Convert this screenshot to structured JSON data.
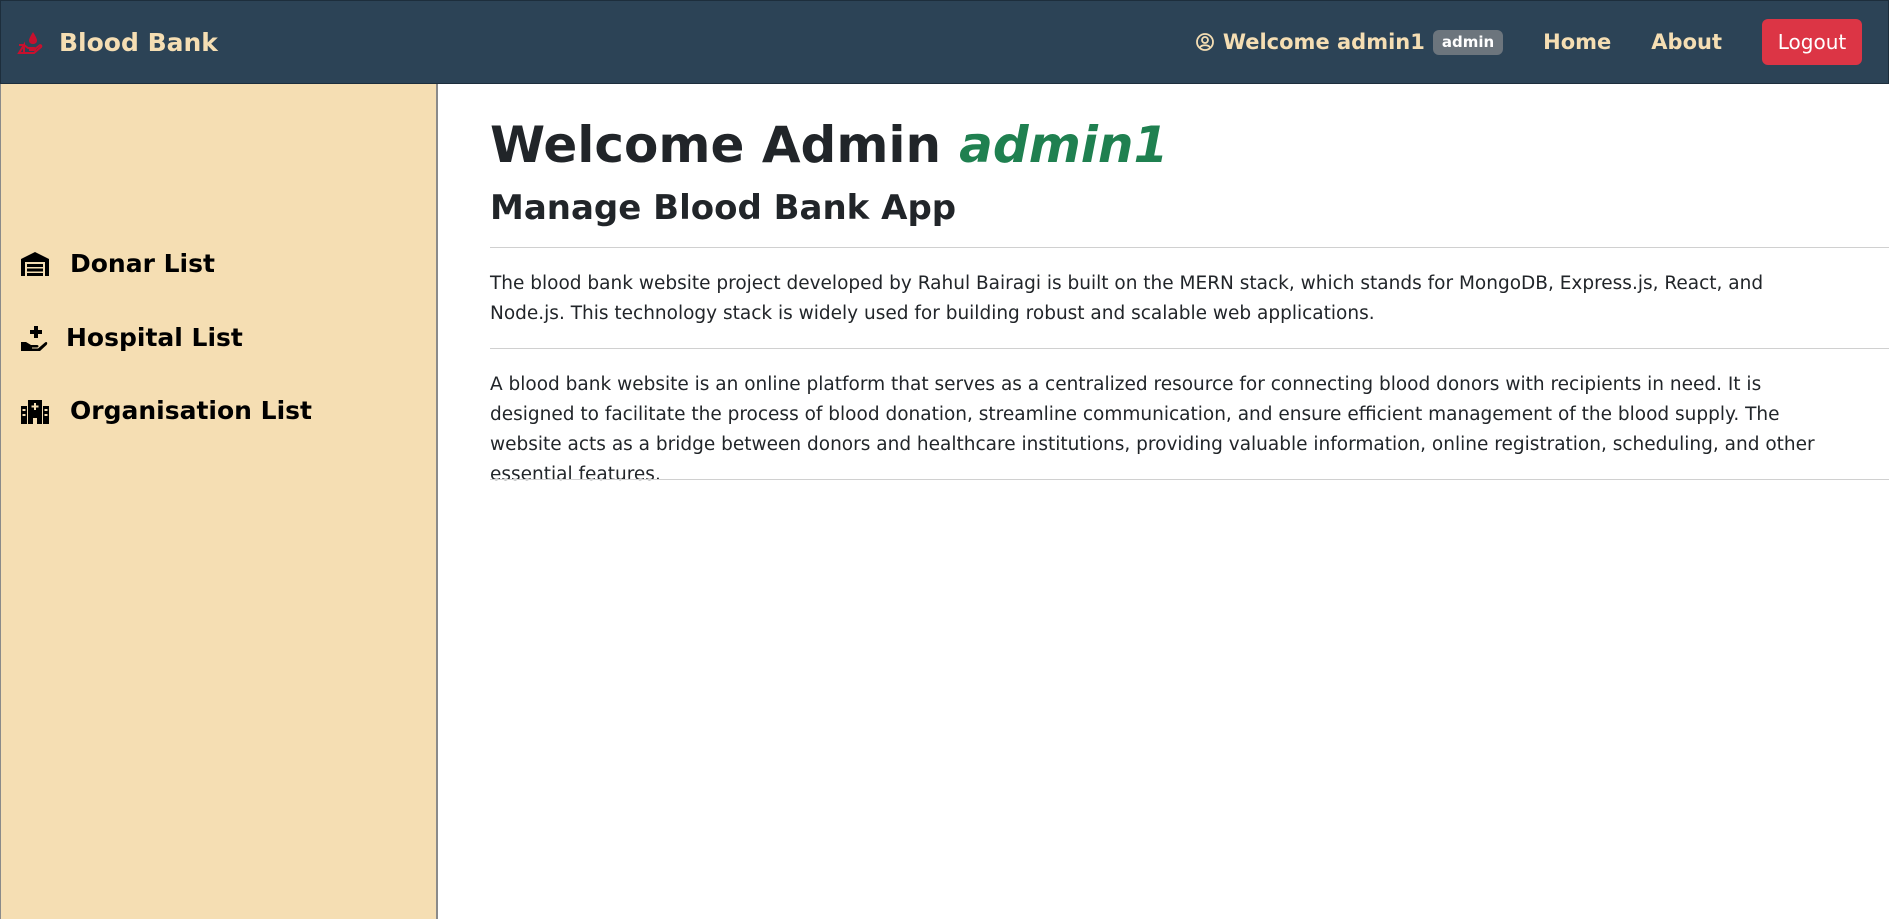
{
  "navbar": {
    "brand_icon": "blood-drop-hand-icon",
    "brand_name": "Blood Bank",
    "user_icon": "user-circle-icon",
    "welcome_text": "Welcome admin1",
    "role_badge": "admin",
    "links": [
      "Home",
      "About"
    ],
    "logout_label": "Logout"
  },
  "sidebar": {
    "items": [
      {
        "icon": "warehouse-icon",
        "label": "Donar List"
      },
      {
        "icon": "hand-holding-medical-icon",
        "label": "Hospital List"
      },
      {
        "icon": "hospital-building-icon",
        "label": "Organisation List"
      }
    ]
  },
  "main": {
    "title": "Welcome Admin",
    "admin_name": "admin1",
    "subtitle": "Manage Blood Bank App",
    "paragraphs": [
      "The blood bank website project developed by Rahul Bairagi is built on the MERN stack, which stands for MongoDB, Express.js, React, and Node.js. This technology stack is widely used for building robust and scalable web applications.",
      "A blood bank website is an online platform that serves as a centralized resource for connecting blood donors with recipients in need. It is designed to facilitate the process of blood donation, streamline communication, and ensure efficient management of the blood supply. The website acts as a bridge between donors and healthcare institutions, providing valuable information, online registration, scheduling, and other essential features."
    ]
  },
  "colors": {
    "navbar_bg": "#2c4356",
    "accent_wheat": "#f5deb3",
    "logout_red": "#dc3545",
    "admin_green": "#1f8050",
    "badge_gray": "#6c757d"
  }
}
